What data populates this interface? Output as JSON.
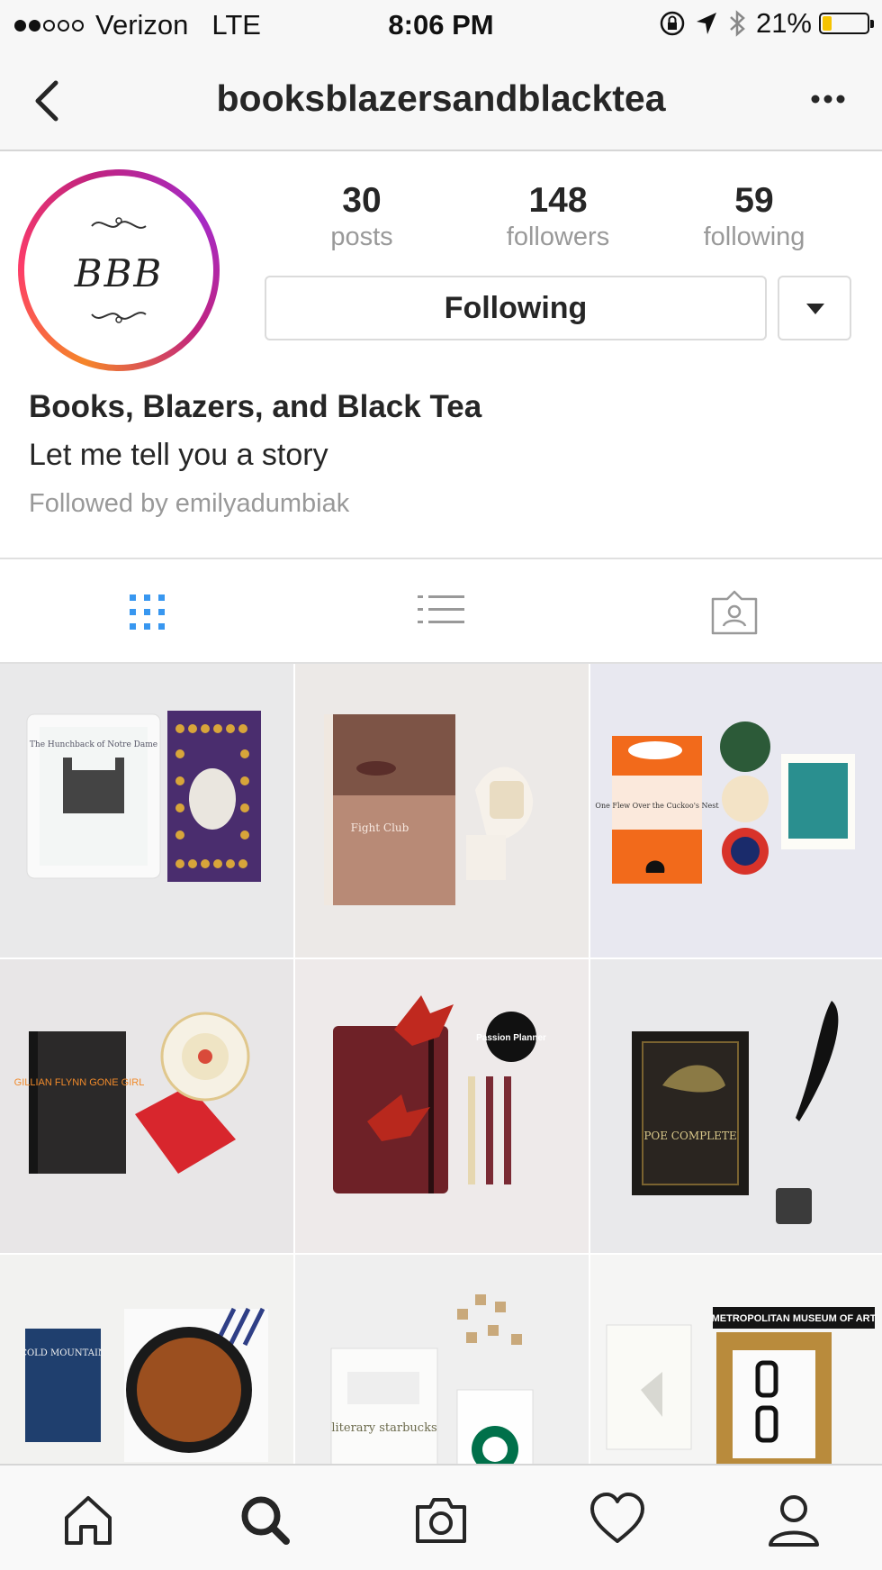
{
  "status_bar": {
    "carrier": "Verizon",
    "network": "LTE",
    "time": "8:06 PM",
    "battery_text": "21%",
    "battery_level": 0.21,
    "signal_bars": 2,
    "signal_total": 5
  },
  "nav": {
    "title": "booksblazersandblacktea",
    "back_icon": "chevron-left-icon",
    "more_icon": "more-horizontal-icon"
  },
  "profile": {
    "avatar_monogram": "BBB",
    "stats": [
      {
        "value": "30",
        "label": "posts"
      },
      {
        "value": "148",
        "label": "followers"
      },
      {
        "value": "59",
        "label": "following"
      }
    ],
    "follow_button": "Following",
    "display_name": "Books, Blazers, and Black Tea",
    "bio": "Let me tell you a story",
    "followed_by": "Followed by emilyadumbiak"
  },
  "tabs": [
    {
      "name": "grid-icon",
      "active": true
    },
    {
      "name": "list-icon",
      "active": false
    },
    {
      "name": "tagged-icon",
      "active": false
    }
  ],
  "colors": {
    "accent_blue": "#3897f0",
    "ring_orange": "#f58529",
    "ring_magenta": "#c0237f",
    "battery_yellow": "#f5c300"
  },
  "posts": [
    {
      "caption": "The Hunchback of Notre Dame"
    },
    {
      "caption": "Fight Club"
    },
    {
      "caption": "One Flew Over the Cuckoo's Nest"
    },
    {
      "caption": "GILLIAN FLYNN GONE GIRL"
    },
    {
      "caption": "Passion Planner"
    },
    {
      "caption": "POE COMPLETE"
    },
    {
      "caption": "COLD MOUNTAIN"
    },
    {
      "caption": "literary starbucks"
    },
    {
      "caption": "METROPOLITAN MUSEUM OF ART"
    }
  ],
  "tab_bar": [
    {
      "name": "home-icon"
    },
    {
      "name": "search-icon"
    },
    {
      "name": "camera-icon"
    },
    {
      "name": "heart-icon"
    },
    {
      "name": "profile-icon"
    }
  ]
}
